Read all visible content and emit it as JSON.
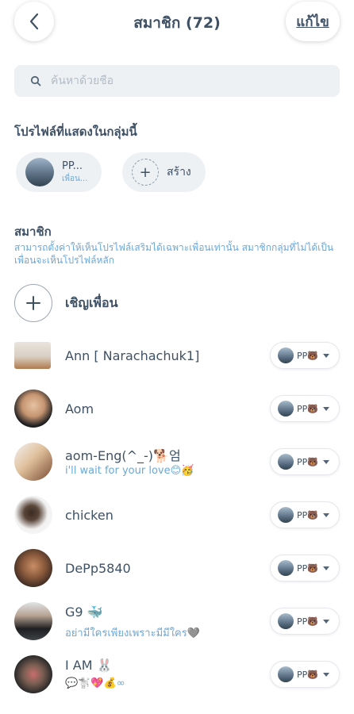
{
  "header": {
    "title": "สมาชิก (72)",
    "edit_label": "แก้ไข",
    "back_icon": "chevron-left-icon"
  },
  "search": {
    "placeholder": "ค้นหาด้วยชื่อ",
    "icon": "search-icon"
  },
  "profiles_section": {
    "title": "โปรไฟล์ที่แสดงในกลุ่มนี้",
    "profile": {
      "name": "PP...",
      "sub": "เพื่อน..."
    },
    "create_label": "สร้าง"
  },
  "members_section": {
    "title": "สมาชิก",
    "note": "สามารถตั้งค่าให้เห็นโปรไฟล์เสริมได้เฉพาะเพื่อนเท่านั้น สมาชิกกลุ่มที่ไม่ได้เป็นเพื่อนจะเห็นโปรไฟล์หลัก",
    "invite_label": "เชิญเพื่อน"
  },
  "members": [
    {
      "name": "Ann [ Narachachuk1]",
      "status": "",
      "badge": "PP🐻"
    },
    {
      "name": "Aom",
      "status": "",
      "badge": "PP🐻"
    },
    {
      "name": "aom-Eng(^_-)🐕엄",
      "status": "i'll wait for your love😊🥳",
      "badge": "PP🐻"
    },
    {
      "name": "chicken",
      "status": "",
      "badge": "PP🐻"
    },
    {
      "name": "DePp5840",
      "status": "",
      "badge": "PP🐻"
    },
    {
      "name": "G9 🐳",
      "status": "อย่ามีใครเพียงเพราะมีมีใคร🩶",
      "badge": "PP🐻"
    },
    {
      "name": "I AM 🐰",
      "status": "💬🐩💖💰∞",
      "badge": "PP🐻"
    }
  ],
  "colors": {
    "text": "#3f5165",
    "accent_blue": "#6aa8d8",
    "search_bg": "#eef1f4"
  }
}
